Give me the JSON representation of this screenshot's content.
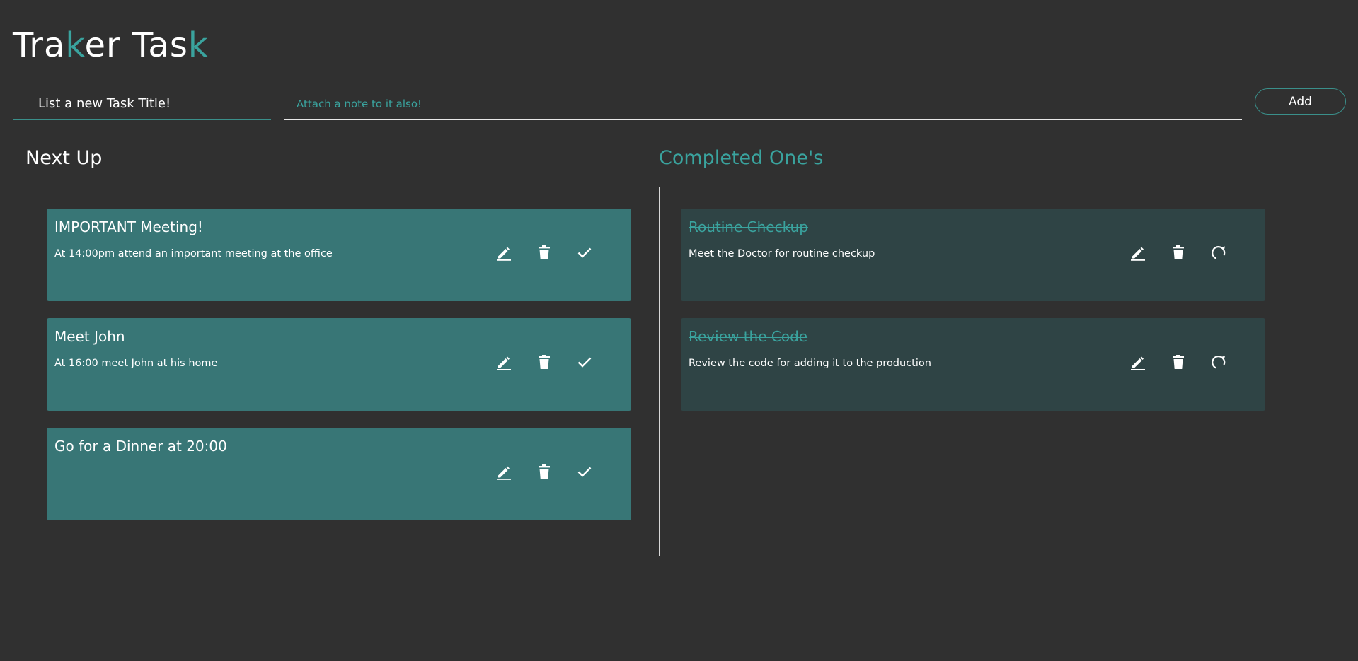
{
  "app": {
    "title_parts": [
      {
        "text": "Tra",
        "accent": false
      },
      {
        "text": "k",
        "accent": true
      },
      {
        "text": "er Tas",
        "accent": false
      },
      {
        "text": "k",
        "accent": true
      }
    ],
    "accent_color": "#3aa39e",
    "background_color": "#303030"
  },
  "form": {
    "title_placeholder": "List a new Task Title!",
    "note_placeholder": "Attach a note to it also!",
    "add_label": "Add"
  },
  "next_up": {
    "heading": "Next Up",
    "card_color": "#387676",
    "tasks": [
      {
        "title": "IMPORTANT Meeting!",
        "note": "At 14:00pm attend an important meeting at the office"
      },
      {
        "title": "Meet John",
        "note": "At 16:00 meet John at his home"
      },
      {
        "title": "Go for a Dinner at 20:00",
        "note": ""
      }
    ],
    "action_icons": [
      "pencil-icon",
      "trash-icon",
      "check-icon"
    ]
  },
  "completed": {
    "heading": "Completed One's",
    "card_color": "#2f4445",
    "tasks": [
      {
        "title": "Routine Checkup",
        "note": "Meet the Doctor for routine checkup"
      },
      {
        "title": "Review the Code",
        "note": "Review the code for adding it to the production"
      }
    ],
    "action_icons": [
      "pencil-icon",
      "trash-icon",
      "redo-icon"
    ]
  }
}
